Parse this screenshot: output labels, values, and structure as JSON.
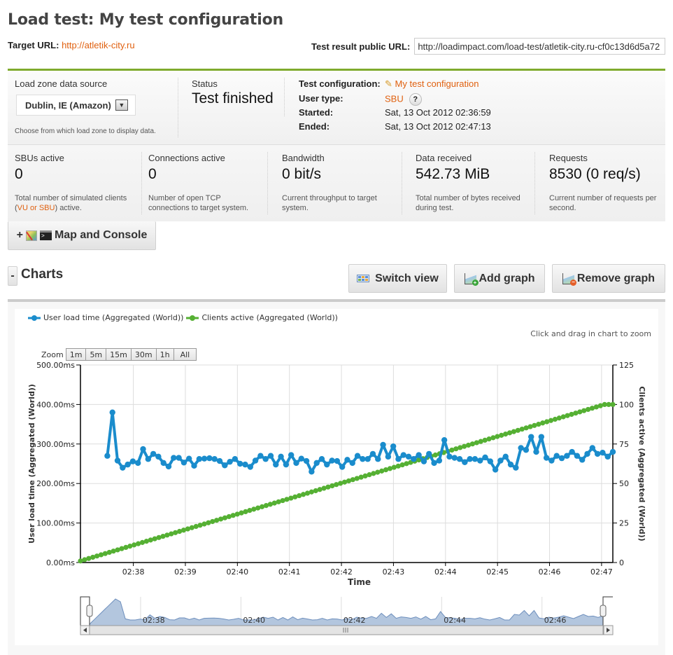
{
  "page": {
    "title": "Load test: My test configuration",
    "target_label": "Target URL:",
    "target_url": "http://atletik-city.ru",
    "public_label": "Test result public URL:",
    "public_url": "http://loadimpact.com/load-test/atletik-city.ru-cf0c13d6d5a72"
  },
  "info": {
    "loadzone_label": "Load zone data source",
    "loadzone_value": "Dublin, IE (Amazon)",
    "loadzone_hint": "Choose from which load zone to display data.",
    "status_label": "Status",
    "status_value": "Test finished",
    "config_label": "Test configuration:",
    "config_value": "My test configuration",
    "usertype_label": "User type:",
    "usertype_value": "SBU",
    "usertype_help": "?",
    "started_label": "Started:",
    "started_value": "Sat, 13 Oct 2012 02:36:59",
    "ended_label": "Ended:",
    "ended_value": "Sat, 13 Oct 2012 02:47:13"
  },
  "metrics": [
    {
      "label": "SBUs active",
      "value": "0",
      "desc_pre": "Total number of simulated clients (",
      "desc_link": "VU or SBU",
      "desc_post": ") active."
    },
    {
      "label": "Connections active",
      "value": "0",
      "desc_pre": "Number of open TCP connections to target system.",
      "desc_link": "",
      "desc_post": ""
    },
    {
      "label": "Bandwidth",
      "value": "0 bit/s",
      "desc_pre": "Current throughput to target system.",
      "desc_link": "",
      "desc_post": ""
    },
    {
      "label": "Data received",
      "value": "542.73 MiB",
      "desc_pre": "Total number of bytes received during test.",
      "desc_link": "",
      "desc_post": ""
    },
    {
      "label": "Requests",
      "value": "8530 (0 req/s)",
      "desc_pre": "Current number of requests per second.",
      "desc_link": "",
      "desc_post": ""
    }
  ],
  "buttons": {
    "map_console_prefix": "+",
    "map_console": "Map and Console",
    "charts_toggle": "-",
    "charts_title": "Charts",
    "switch_view": "Switch view",
    "add_graph": "Add graph",
    "remove_graph": "Remove graph"
  },
  "chart_ui": {
    "hint": "Click and drag in chart to zoom",
    "zoom_label": "Zoom",
    "zoom_options": [
      "1m",
      "5m",
      "15m",
      "30m",
      "1h",
      "All"
    ]
  },
  "colors": {
    "accent_green": "#7fab2e",
    "link_orange": "#e0600f",
    "series_blue": "#1a8ccc",
    "series_green": "#55b033",
    "navigator_fill": "#b3c6de",
    "navigator_line": "#6e8fbd"
  },
  "chart_data": {
    "type": "line",
    "title": "",
    "xlabel": "Time",
    "ylabel": "User load time (Aggregated (World))",
    "y2label": "Clients active (Aggregated (World))",
    "x_range": [
      "02:36:59",
      "02:47:13"
    ],
    "x_ticks": [
      "02:38",
      "02:39",
      "02:40",
      "02:41",
      "02:42",
      "02:43",
      "02:44",
      "02:45",
      "02:46",
      "02:47"
    ],
    "y_ticks": [
      "0.00ms",
      "100.00ms",
      "200.00ms",
      "300.00ms",
      "400.00ms",
      "500.00ms"
    ],
    "y2_ticks": [
      "0",
      "25",
      "50",
      "75",
      "100",
      "125"
    ],
    "ylim": [
      0,
      500
    ],
    "y2lim": [
      0,
      125
    ],
    "grid": true,
    "legend": "top-left",
    "series": [
      {
        "name": "User load time (Aggregated (World))",
        "axis": "left",
        "unit": "ms",
        "start": "02:37:30",
        "end": "02:47:13",
        "values": [
          270,
          380,
          258,
          240,
          248,
          256,
          252,
          287,
          262,
          275,
          268,
          252,
          243,
          265,
          265,
          253,
          263,
          245,
          262,
          263,
          264,
          262,
          257,
          246,
          255,
          262,
          250,
          248,
          242,
          258,
          270,
          262,
          270,
          248,
          268,
          248,
          272,
          252,
          263,
          257,
          230,
          252,
          262,
          248,
          258,
          257,
          242,
          260,
          252,
          270,
          262,
          262,
          275,
          262,
          298,
          268,
          294,
          262,
          272,
          268,
          262,
          272,
          256,
          275,
          252,
          258,
          310,
          268,
          265,
          262,
          254,
          262,
          262,
          258,
          266,
          256,
          235,
          258,
          268,
          248,
          240,
          290,
          285,
          318,
          280,
          318,
          265,
          258,
          270,
          264,
          270,
          280,
          270,
          260,
          275,
          290,
          275,
          278,
          268,
          280
        ]
      },
      {
        "name": "Clients active (Aggregated (World))",
        "axis": "right",
        "unit": "clients",
        "start": "02:36:59",
        "end": "02:47:13",
        "linear_from": 1,
        "linear_to": 100,
        "plateau_last": 2
      }
    ],
    "navigator": {
      "x_labels": [
        "02:38",
        "02:40",
        "02:42",
        "02:44",
        "02:46"
      ]
    }
  }
}
